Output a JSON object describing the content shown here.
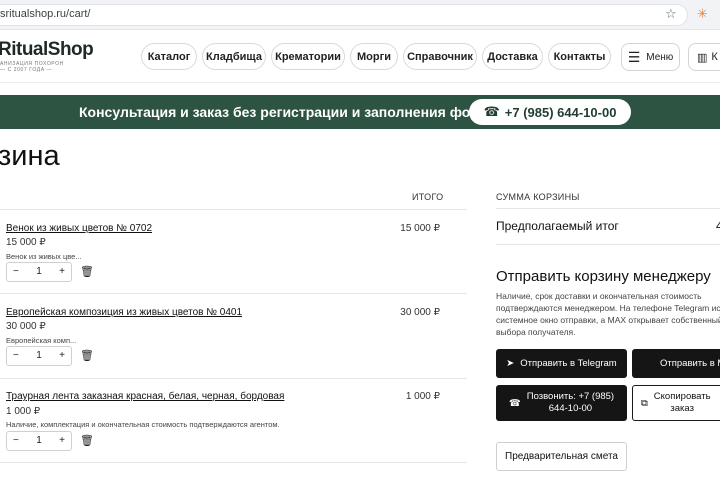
{
  "browser": {
    "url": "sritualshop.ru/cart/"
  },
  "header": {
    "logo": "RitualShop",
    "logo_sub_1": "АНИЗАЦИЯ ПОХОРОН",
    "logo_sub_2": "— С 2007 ГОДА —",
    "nav": [
      {
        "label": "Каталог"
      },
      {
        "label": "Кладбища"
      },
      {
        "label": "Крематории"
      },
      {
        "label": "Морги"
      },
      {
        "label": "Справочник"
      },
      {
        "label": "Доставка"
      },
      {
        "label": "Контакты"
      }
    ],
    "menu_label": "Меню",
    "map_label": "К"
  },
  "banner": {
    "text": "Консультация и заказ без регистрации и заполнения форм",
    "phone": "+7 (985) 644-10-00"
  },
  "page": {
    "title": "зина"
  },
  "cart": {
    "total_header": "ИТОГО",
    "items": [
      {
        "name": "Венок из живых цветов № 0702",
        "price": "15 000 ₽",
        "note": "Венок из живых цве...",
        "qty": "1",
        "total": "15 000 ₽"
      },
      {
        "name": "Европейская композиция из живых цветов № 0401",
        "price": "30 000 ₽",
        "note": "Европейская комп...",
        "qty": "1",
        "total": "30 000 ₽"
      },
      {
        "name": "Траурная лента заказная красная, белая, черная, бордовая",
        "price": "1 000 ₽",
        "note": "Наличие, комплектация и окончательная стоимость подтверждаются агентом.",
        "qty": "1",
        "total": "1 000 ₽"
      }
    ]
  },
  "summary": {
    "header": "СУММА КОРЗИНЫ",
    "estimated_label": "Предполагаемый итог",
    "estimated_value": "4",
    "send_title": "Отправить корзину менеджеру",
    "send_desc": "Наличие, срок доставки и окончательная стоимость подтверждаются менеджером. На телефоне Telegram ис системное окно отправки, а MAX открывает собственный выбора получателя.",
    "btn_telegram": "Отправить в Telegram",
    "btn_max": "Отправить в М",
    "btn_call_1": "Позвонить: +7 (985)",
    "btn_call_2": "644-10-00",
    "btn_copy_1": "Скопировать",
    "btn_copy_2": "заказ",
    "btn_estimate": "Предварительная смета"
  }
}
